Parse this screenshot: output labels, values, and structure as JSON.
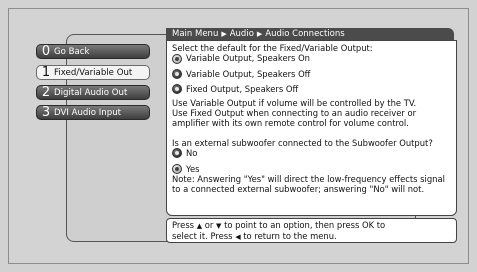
{
  "breadcrumb": {
    "root": "Main Menu",
    "level1": "Audio",
    "current": "Audio Connections"
  },
  "menu": {
    "items": [
      {
        "number": "0",
        "label": "Go Back"
      },
      {
        "number": "1",
        "label": "Fixed/Variable Out"
      },
      {
        "number": "2",
        "label": "Digital Audio Out"
      },
      {
        "number": "3",
        "label": "DVI Audio Input"
      }
    ]
  },
  "content": {
    "output_heading": "Select the default for the Fixed/Variable Output:",
    "output_options": [
      {
        "label": "Variable Output, Speakers On",
        "selected": true
      },
      {
        "label": "Variable Output, Speakers Off",
        "selected": false
      },
      {
        "label": "Fixed Output, Speakers Off",
        "selected": false
      }
    ],
    "info_lines": [
      "Use Variable Output if volume will be controlled by the TV.",
      "Use Fixed Output when connecting to an audio receiver or",
      "amplifier with its own remote control for volume control."
    ],
    "subwoofer_question": "Is an external subwoofer connected to the Subwoofer Output?",
    "subwoofer_options": [
      {
        "label": "No",
        "selected": false
      },
      {
        "label": "Yes",
        "selected": true
      }
    ],
    "note_lines": [
      "Note: Answering \"Yes\" will direct the low-frequency effects signal",
      "to a connected external subwoofer; answering \"No\" will not."
    ]
  },
  "hint": {
    "l1_a": "Press",
    "l1_b": "or",
    "l1_c": "to point to an option, then press OK to",
    "l2_a": "select it. Press",
    "l2_b": "to return to the menu."
  }
}
